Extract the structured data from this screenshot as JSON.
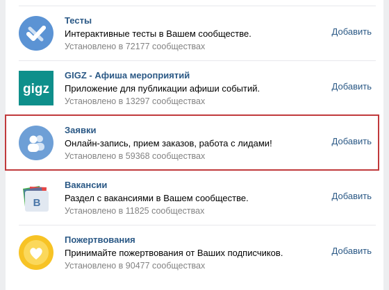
{
  "apps": [
    {
      "name": "Тесты",
      "description": "Интерактивные тесты в Вашем сообществе.",
      "installed": "Установлено в 72177 сообществах",
      "action": "Добавить",
      "icon": "checkmark-icon",
      "icon_color": "#5b93d4"
    },
    {
      "name": "GIGZ - Афиша мероприятий",
      "description": "Приложение для публикации афиши событий.",
      "installed": "Установлено в 13297 сообществах",
      "action": "Добавить",
      "icon": "gigz-logo-icon",
      "icon_color": "#0e8f8b",
      "icon_text": "gigz"
    },
    {
      "name": "Заявки",
      "description": "Онлайн-запись, прием заказов, работа с лидами!",
      "installed": "Установлено в 59368 сообществах",
      "action": "Добавить",
      "icon": "users-icon",
      "icon_color": "#6e9fd6",
      "highlighted": true
    },
    {
      "name": "Вакансии",
      "description": "Раздел с вакансиями в Вашем сообществе.",
      "installed": "Установлено в 11825 сообществах",
      "action": "Добавить",
      "icon": "vacancies-cards-icon",
      "icon_color": "#4a76a8",
      "icon_text": "B"
    },
    {
      "name": "Пожертвования",
      "description": "Принимайте пожертвования от Ваших подписчиков.",
      "installed": "Установлено в 90477 сообществах",
      "action": "Добавить",
      "icon": "heart-coin-icon",
      "icon_color": "#f7c325"
    }
  ],
  "colors": {
    "link": "#2a5885",
    "highlight_border": "#c0393b",
    "secondary_text": "#828282"
  }
}
